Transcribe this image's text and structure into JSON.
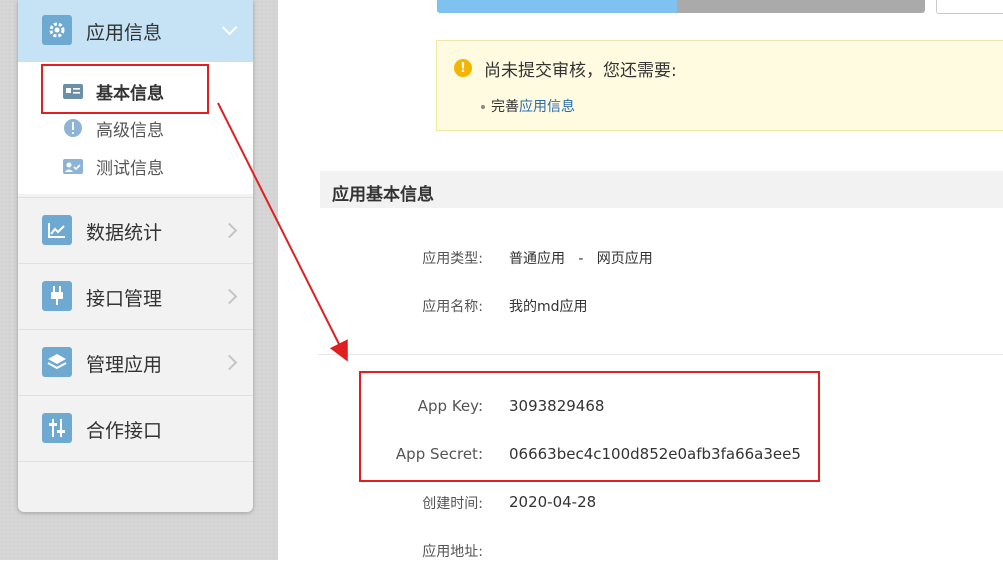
{
  "sidebar": {
    "app_info": {
      "label": "应用信息",
      "icon": "gear-icon"
    },
    "submenu": [
      {
        "label": "基本信息",
        "icon": "id-card-icon",
        "active": true
      },
      {
        "label": "高级信息",
        "icon": "alert-circle-icon",
        "active": false
      },
      {
        "label": "测试信息",
        "icon": "user-check-icon",
        "active": false
      }
    ],
    "items": [
      {
        "label": "数据统计",
        "icon": "line-chart-icon"
      },
      {
        "label": "接口管理",
        "icon": "plug-icon"
      },
      {
        "label": "管理应用",
        "icon": "layers-icon"
      },
      {
        "label": "合作接口",
        "icon": "sliders-icon"
      }
    ]
  },
  "notice": {
    "title": "尚未提交审核，您还需要:",
    "bullet_prefix": "完善",
    "bullet_link": "应用信息"
  },
  "section": {
    "title": "应用基本信息"
  },
  "fields": {
    "app_type": {
      "label": "应用类型:",
      "value": "普通应用   -   网页应用"
    },
    "app_name": {
      "label": "应用名称:",
      "value": "我的md应用"
    },
    "app_key": {
      "label": "App Key:",
      "value": "3093829468"
    },
    "app_secret": {
      "label": "App Secret:",
      "value": "06663bec4c100d852e0afb3fa66a3ee5"
    },
    "created": {
      "label": "创建时间:",
      "value": "2020-04-28"
    },
    "app_url": {
      "label": "应用地址:",
      "value": ""
    }
  },
  "colors": {
    "accent": "#6ea9d2",
    "active_bg": "#c5e3f5",
    "annotation": "#e02020",
    "link": "#2a6cb0"
  }
}
